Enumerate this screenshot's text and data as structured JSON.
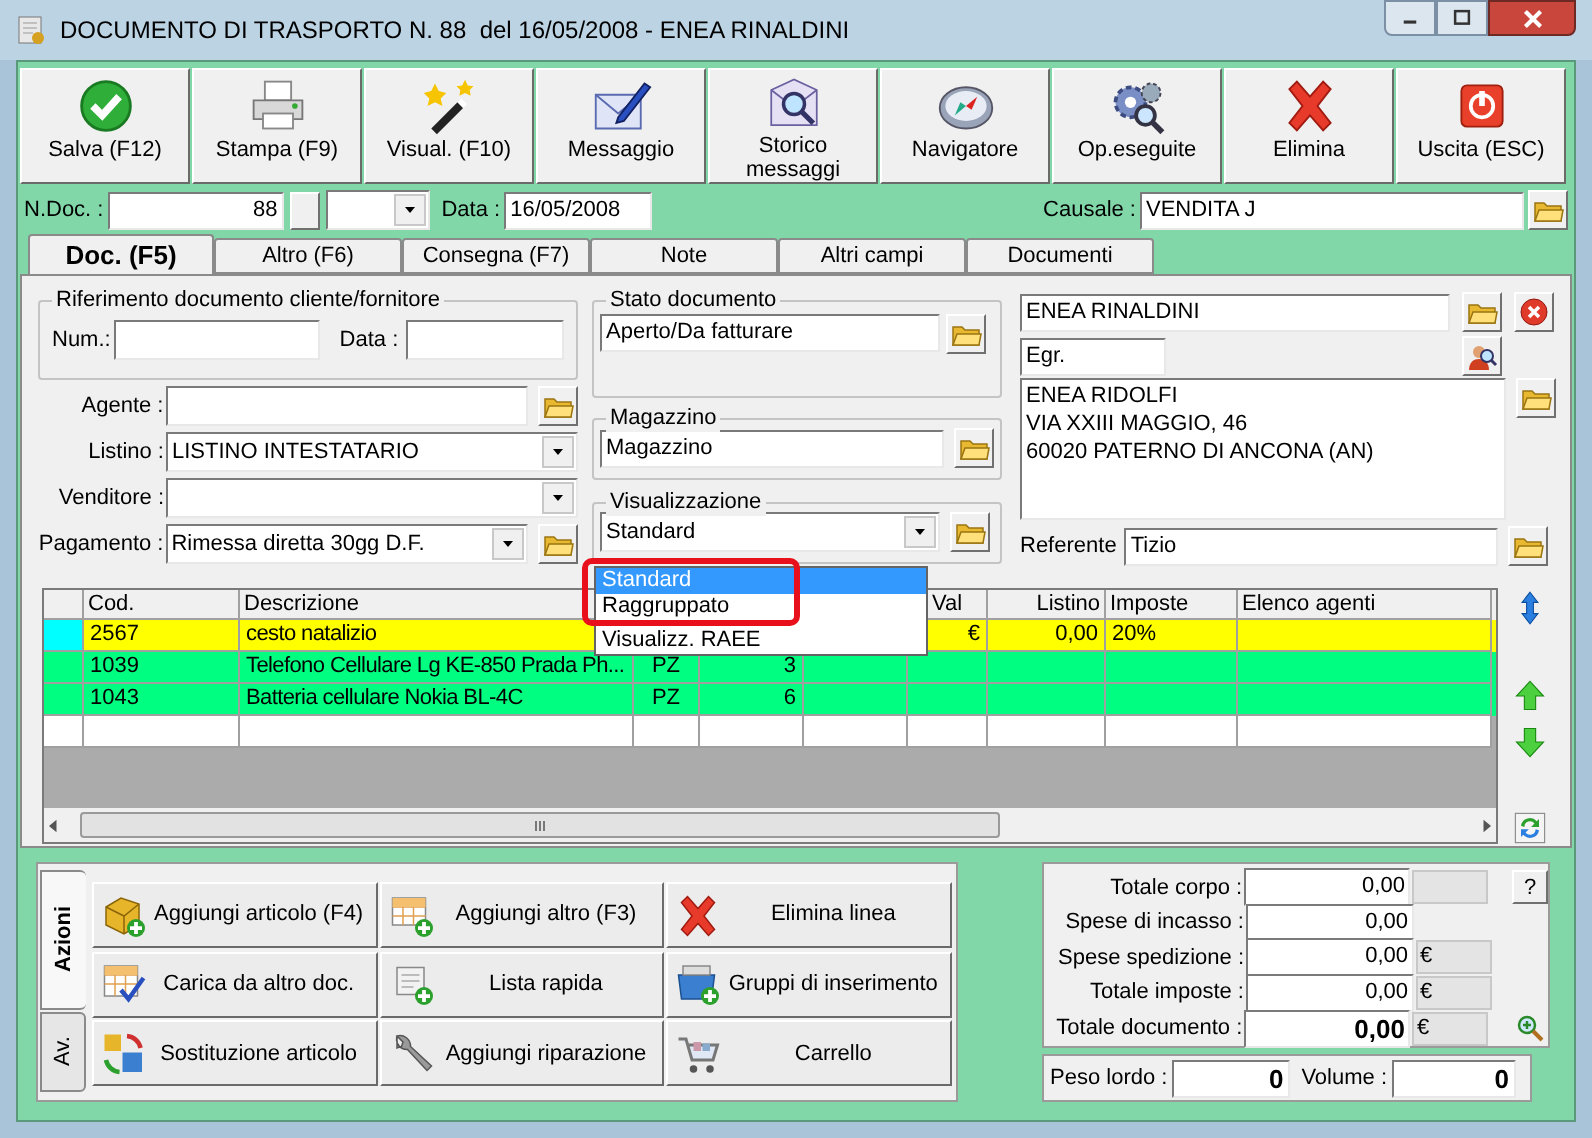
{
  "window": {
    "title": "DOCUMENTO DI TRASPORTO N. 88  del 16/05/2008 - ENEA RINALDINI"
  },
  "toolbar": [
    {
      "label": "Salva (F12)"
    },
    {
      "label": "Stampa (F9)"
    },
    {
      "label": "Visual. (F10)"
    },
    {
      "label": "Messaggio"
    },
    {
      "label": "Storico messaggi"
    },
    {
      "label": "Navigatore"
    },
    {
      "label": "Op.eseguite"
    },
    {
      "label": "Elimina"
    },
    {
      "label": "Uscita (ESC)"
    }
  ],
  "header": {
    "n_doc_label": "N.Doc. :",
    "n_doc": "88",
    "data_label": "Data :",
    "data": "16/05/2008",
    "causale_label": "Causale :",
    "causale": "VENDITA J"
  },
  "tabs": [
    {
      "label": "Doc. (F5)",
      "selected": true
    },
    {
      "label": "Altro (F6)",
      "selected": false
    },
    {
      "label": "Consegna (F7)",
      "selected": false
    },
    {
      "label": "Note",
      "selected": false
    },
    {
      "label": "Altri campi",
      "selected": false
    },
    {
      "label": "Documenti",
      "selected": false
    }
  ],
  "riferimento": {
    "title": "Riferimento documento cliente/fornitore",
    "num_label": "Num.:",
    "data_label": "Data :"
  },
  "fields": {
    "agente_label": "Agente :",
    "listino_label": "Listino :",
    "listino": "LISTINO INTESTATARIO",
    "venditore_label": "Venditore :",
    "pagamento_label": "Pagamento :",
    "pagamento": "Rimessa diretta 30gg D.F."
  },
  "stato_documento": {
    "title": "Stato documento",
    "value": "Aperto/Da fatturare"
  },
  "magazzino": {
    "title": "Magazzino",
    "value": "Magazzino"
  },
  "visualizzazione": {
    "title": "Visualizzazione",
    "value": "Standard",
    "options": [
      {
        "label": "Standard",
        "selected": true
      },
      {
        "label": "Raggruppato",
        "selected": false
      },
      {
        "label": "Visualizz. RAEE",
        "selected": false
      }
    ]
  },
  "cliente": {
    "name": "ENEA RINALDINI",
    "salutation": "Egr.",
    "address": [
      "ENEA RIDOLFI",
      "VIA XXIII MAGGIO, 46",
      "60020 PATERNO DI ANCONA (AN)"
    ],
    "referente_label": "Referente",
    "referente": "Tizio"
  },
  "grid": {
    "headers": {
      "cod": "Cod.",
      "descrizione": "Descrizione",
      "val": "Val",
      "listino": "Listino",
      "imposte": "Imposte",
      "agenti": "Elenco agenti"
    },
    "rows": [
      {
        "cod": "2567",
        "descrizione": "cesto natalizio",
        "val": "€",
        "listino": "0,00",
        "imposte": "20%",
        "color": "#ffff00",
        "selected": true
      },
      {
        "cod": "1039",
        "descrizione": "Telefono Cellulare Lg KE-850 Prada Ph...",
        "um": "PZ",
        "qta": "3",
        "color": "#00ff80",
        "selected": false
      },
      {
        "cod": "1043",
        "descrizione": "Batteria cellulare Nokia BL-4C",
        "um": "PZ",
        "qta": "6",
        "color": "#00ff80",
        "selected": false
      }
    ]
  },
  "side_tabs": [
    {
      "label": "Azioni",
      "selected": true
    },
    {
      "label": "Av.",
      "selected": false
    }
  ],
  "actions": [
    {
      "label": "Aggiungi articolo (F4)"
    },
    {
      "label": "Aggiungi altro (F3)"
    },
    {
      "label": "Elimina linea"
    },
    {
      "label": "Carica da altro doc."
    },
    {
      "label": "Lista rapida"
    },
    {
      "label": "Gruppi di inserimento"
    },
    {
      "label": "Sostituzione articolo"
    },
    {
      "label": "Aggiungi riparazione"
    },
    {
      "label": "Carrello"
    }
  ],
  "totals": [
    {
      "label": "Totale corpo :",
      "value": "0,00",
      "kind": "help",
      "button": "?"
    },
    {
      "label": "Spese di incasso :",
      "value": "0,00",
      "kind": "plain"
    },
    {
      "label": "Spese spedizione :",
      "value": "0,00",
      "kind": "currency",
      "currency": "€"
    },
    {
      "label": "Totale imposte :",
      "value": "0,00",
      "kind": "currency",
      "currency": "€"
    },
    {
      "label": "Totale documento :",
      "value": "0,00",
      "kind": "total",
      "currency": "€"
    }
  ],
  "weights": {
    "peso_label": "Peso lordo :",
    "peso": "0",
    "volume_label": "Volume :",
    "volume": "0"
  }
}
